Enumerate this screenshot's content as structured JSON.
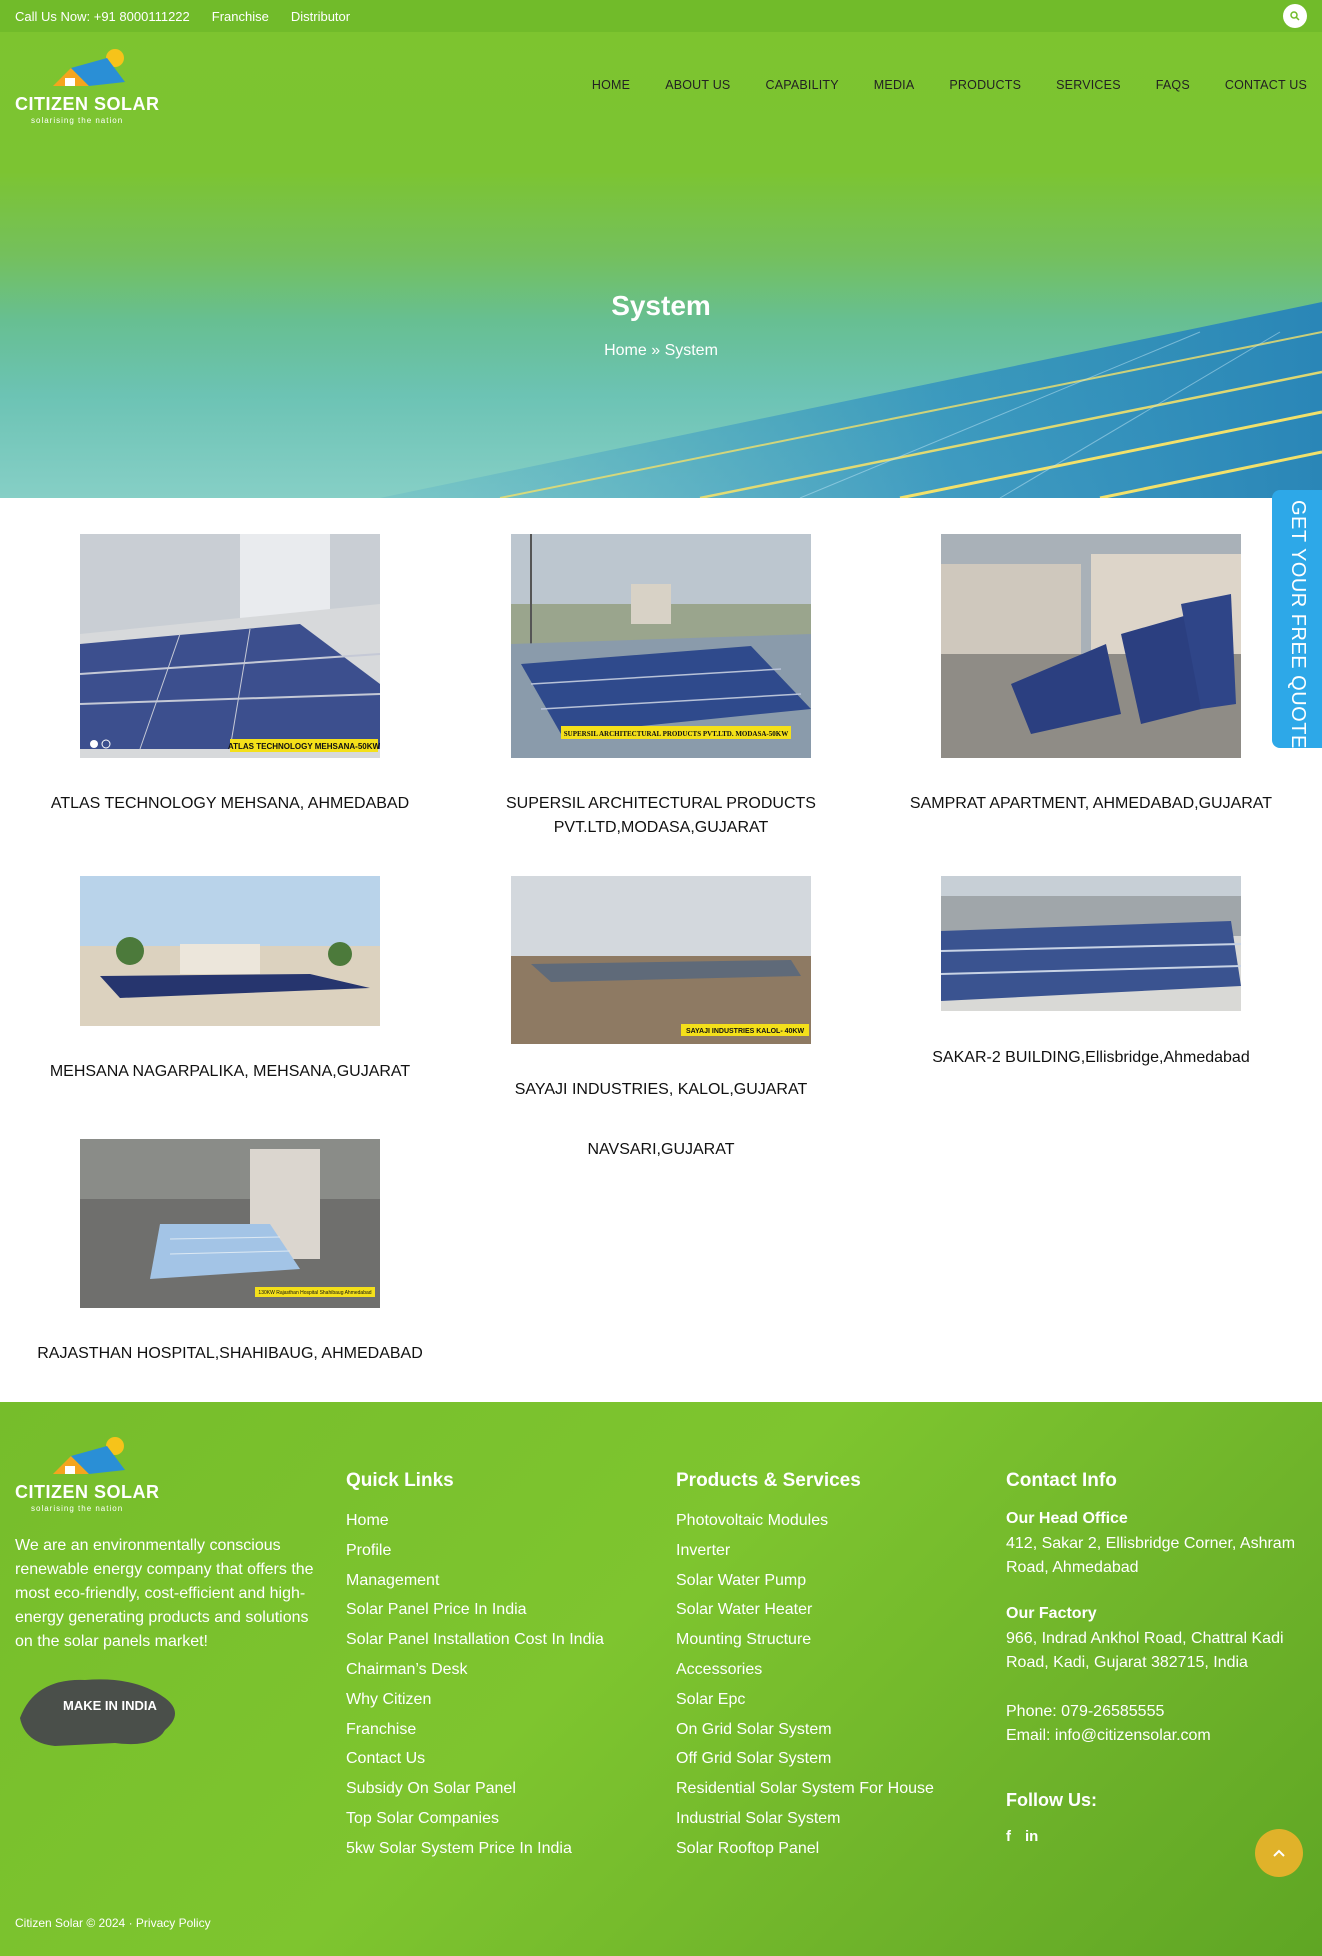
{
  "topbar": {
    "phone": "Call Us Now: +91 8000111222",
    "franchise": "Franchise",
    "distributor": "Distributor",
    "search_icon": "search-icon"
  },
  "brand": {
    "name": "CITIZEN SOLAR",
    "tagline": "solarising the nation"
  },
  "nav": [
    "HOME",
    "ABOUT US",
    "CAPABILITY",
    "MEDIA",
    "PRODUCTS",
    "SERVICES",
    "FAQS",
    "CONTACT US"
  ],
  "hero": {
    "title": "System",
    "breadcrumb": "Home » System"
  },
  "quote_tab": "GET YOUR FREE QUOTE",
  "projects": [
    {
      "caption": "ATLAS TECHNOLOGY MEHSANA, AHMEDABAD",
      "banner": "ATLAS TECHNOLOGY MEHSANA-50KW"
    },
    {
      "caption": "SUPERSIL ARCHITECTURAL PRODUCTS PVT.LTD,MODASA,GUJARAT",
      "banner": "SUPERSIL ARCHITECTURAL PRODUCTS PVT.LTD. MODASA-50KW"
    },
    {
      "caption": "SAMPRAT APARTMENT, AHMEDABAD,GUJARAT",
      "banner": ""
    },
    {
      "caption": "MEHSANA NAGARPALIKA, MEHSANA,GUJARAT",
      "banner": ""
    },
    {
      "caption": "SAYAJI INDUSTRIES, KALOL,GUJARAT",
      "banner": "SAYAJI INDUSTRIES KALOL- 40KW"
    },
    {
      "caption": "SAKAR-2 BUILDING,Ellisbridge,Ahmedabad",
      "banner": ""
    },
    {
      "caption": "RAJASTHAN HOSPITAL,SHAHIBAUG, AHMEDABAD",
      "banner": "130KW Rajasthan Hospital Shahibaug Ahmedabad"
    },
    {
      "caption": "NAVSARI,GUJARAT",
      "banner": ""
    }
  ],
  "footer": {
    "about": "We are an environmentally conscious renewable energy company that offers the most eco-friendly, cost-efficient and high-energy generating products and solutions on the solar panels market!",
    "make_in_india": "MAKE IN INDIA",
    "quick_links_title": "Quick Links",
    "quick_links": [
      "Home",
      "Profile",
      "Management",
      "Solar Panel Price In India",
      "Solar Panel Installation Cost In India",
      "Chairman’s Desk",
      "Why Citizen",
      "Franchise",
      "Contact Us",
      "Subsidy On Solar Panel",
      "Top Solar Companies",
      "5kw Solar System Price In India"
    ],
    "products_title": "Products & Services",
    "products": [
      "Photovoltaic Modules",
      "Inverter",
      "Solar Water Pump",
      "Solar Water Heater",
      "Mounting Structure",
      "Accessories",
      "Solar Epc",
      "On Grid Solar System",
      "Off Grid Solar System",
      "Residential Solar System For House",
      "Industrial Solar System",
      "Solar Rooftop Panel"
    ],
    "contact_title": "Contact Info",
    "head_office_label": "Our Head Office",
    "head_office": "412, Sakar 2, Ellisbridge Corner, Ashram Road, Ahmedabad",
    "factory_label": "Our Factory",
    "factory": "966, Indrad Ankhol Road, Chattral Kadi Road, Kadi, Gujarat 382715, India",
    "phone": "Phone: 079-26585555",
    "email": "Email: info@citizensolar.com",
    "follow": "Follow Us:",
    "social": [
      "f",
      "in"
    ],
    "copyright": "Citizen Solar © 2024 · Privacy Policy"
  }
}
